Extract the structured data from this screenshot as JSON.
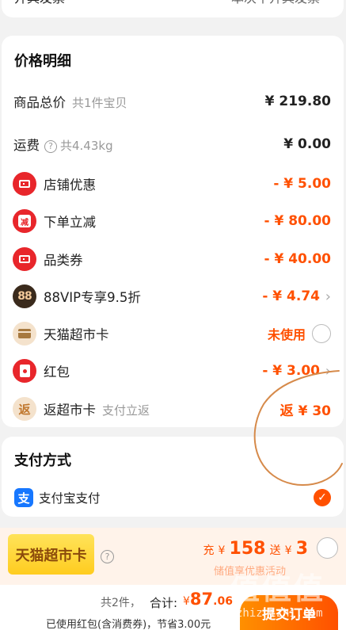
{
  "invoice": {
    "label": "开具发票",
    "value": "本次不开具发票"
  },
  "price_detail": {
    "title": "价格明细",
    "goods_total": {
      "label": "商品总价",
      "sub": "共1件宝贝",
      "amount": "¥ 219.80"
    },
    "shipping": {
      "label": "运费",
      "info_glyph": "?",
      "sub": "共4.43kg",
      "amount": "¥ 0.00"
    },
    "discounts": [
      {
        "label": "店铺优惠",
        "amount": "- ¥ 5.00",
        "icon": "coupon-icon"
      },
      {
        "label": "下单立减",
        "badge": "减",
        "amount": "- ¥ 80.00",
        "icon": "instant-discount-icon"
      },
      {
        "label": "品类券",
        "amount": "- ¥ 40.00",
        "icon": "coupon-icon"
      },
      {
        "label": "88VIP专享9.5折",
        "badge": "88",
        "amount": "- ¥ 4.74",
        "icon": "vip-88-icon",
        "chevron": "›"
      },
      {
        "label": "天猫超市卡",
        "amount": "未使用",
        "icon": "tmall-card-icon"
      },
      {
        "label": "红包",
        "amount": "- ¥ 3.00",
        "icon": "red-packet-icon",
        "chevron": "›"
      },
      {
        "label": "返超市卡",
        "badge": "返",
        "sub": "支付立返",
        "amount": "返 ¥ 30",
        "icon": "cashback-icon"
      }
    ]
  },
  "payment": {
    "title": "支付方式",
    "method": "支付宝支付",
    "alipay_glyph": "支",
    "check_glyph": "✓"
  },
  "promo": {
    "badge": "天猫超市卡",
    "help_glyph": "?",
    "charge_prefix": "充",
    "currency": "¥",
    "charge_amount": "158",
    "gift_prefix": "送",
    "gift_amount": "3",
    "subtext": "储值享优惠活动"
  },
  "footer": {
    "count": "共2件，",
    "total_label": "合计:",
    "currency": "¥",
    "total_int": "87",
    "total_dec": ".06",
    "note": "已使用红包(含消费券)，节省3.00元",
    "submit": "提交订单"
  },
  "watermark": {
    "main": "值值值",
    "site": "zhizhizhi.com"
  },
  "colors": {
    "accent": "#ff5000",
    "red_icon": "#e8262b",
    "alipay": "#1677ff",
    "annotation": "#d68a4a"
  }
}
